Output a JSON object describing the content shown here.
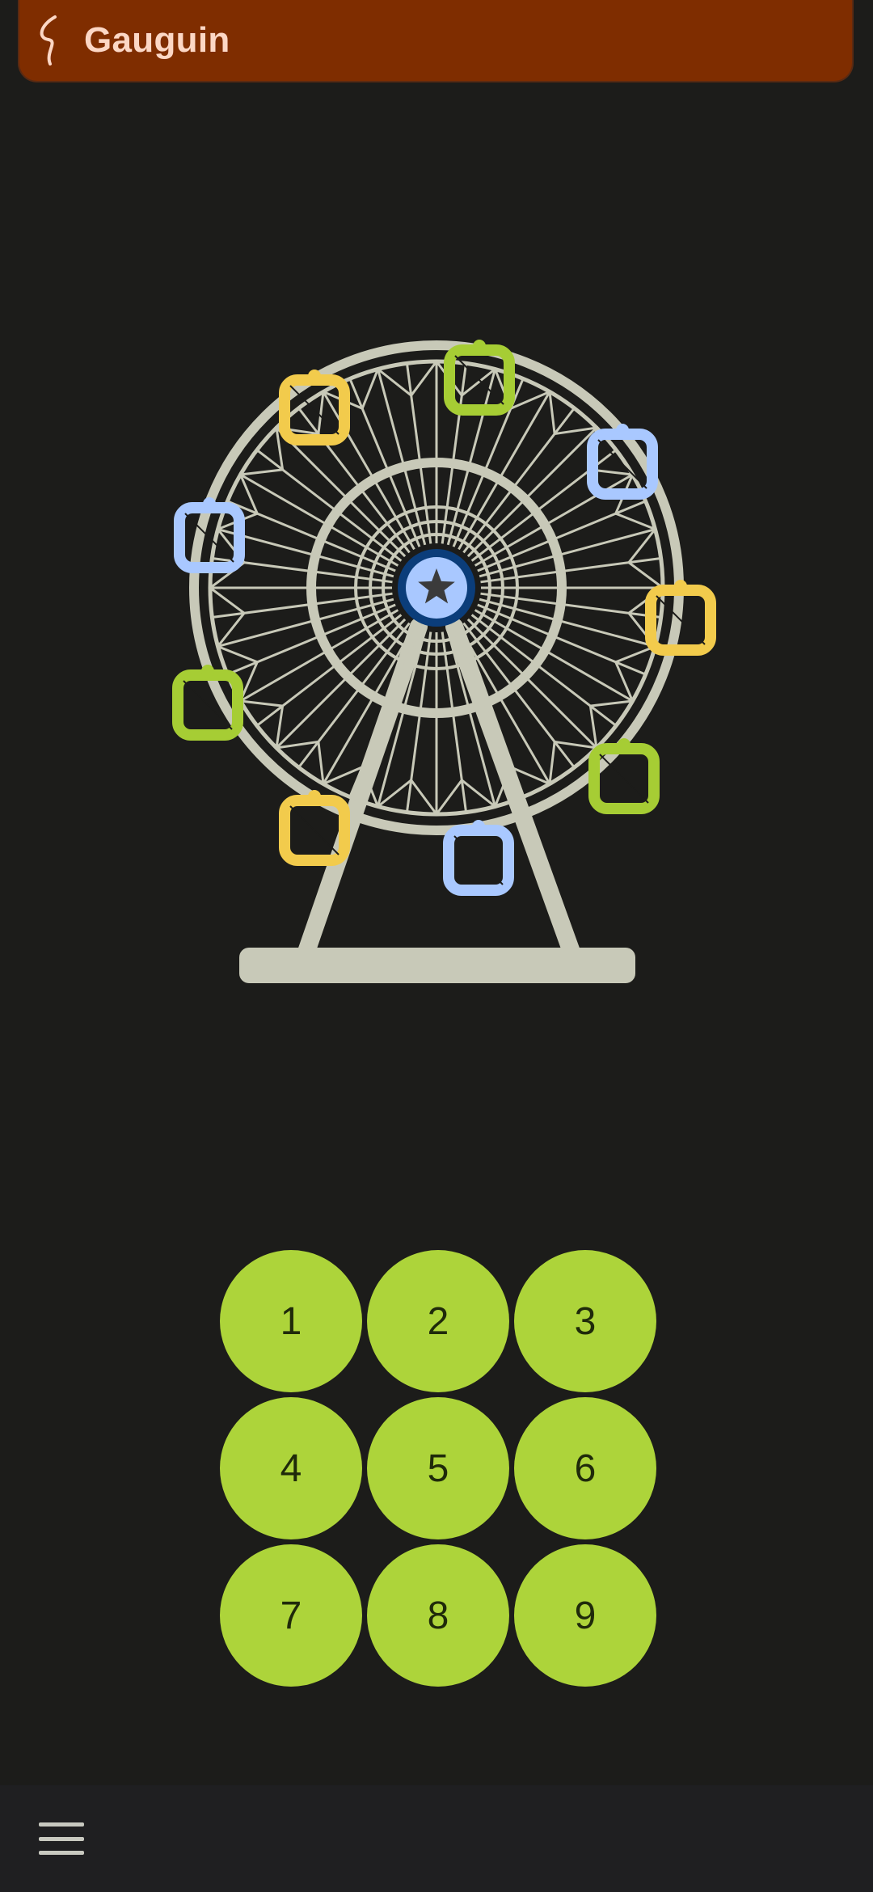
{
  "app": {
    "title": "Gauguin"
  },
  "colors": {
    "app_bar": "#7f2d00",
    "background": "#1c1c1a",
    "key_fill": "#add43a",
    "wheel_structure": "#c8c9b8",
    "hub_ring": "#0b3d7a",
    "hub_fill": "#a9c8ff",
    "cabin_colors": [
      "#f2cb4c",
      "#a6cd34",
      "#a9c8ff"
    ]
  },
  "illustration": {
    "name": "ferris-wheel",
    "hub_icon": "star-icon",
    "cabin_count": 9
  },
  "keypad": {
    "keys": [
      "1",
      "2",
      "3",
      "4",
      "5",
      "6",
      "7",
      "8",
      "9"
    ]
  },
  "bottom_bar": {
    "menu_icon": "hamburger-menu-icon"
  }
}
